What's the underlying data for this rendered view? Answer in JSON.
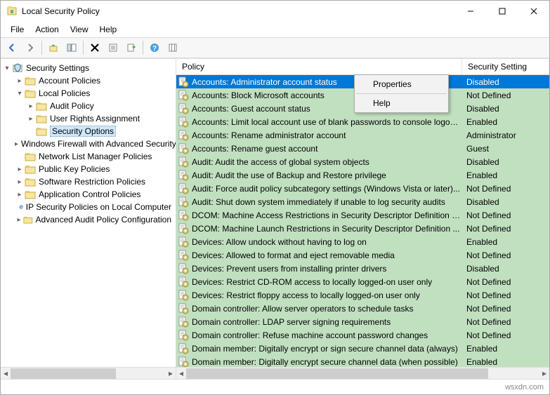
{
  "window": {
    "title": "Local Security Policy"
  },
  "menubar": [
    "File",
    "Action",
    "View",
    "Help"
  ],
  "tree": {
    "root": "Security Settings",
    "nodes": [
      {
        "label": "Account Policies",
        "depth": 1,
        "expanded": false,
        "icon": "folder",
        "twist": "▸"
      },
      {
        "label": "Local Policies",
        "depth": 1,
        "expanded": true,
        "icon": "folder",
        "twist": "▾"
      },
      {
        "label": "Audit Policy",
        "depth": 2,
        "icon": "folder",
        "twist": "▸"
      },
      {
        "label": "User Rights Assignment",
        "depth": 2,
        "icon": "folder",
        "twist": "▸"
      },
      {
        "label": "Security Options",
        "depth": 2,
        "icon": "folder",
        "twist": "",
        "selected": true
      },
      {
        "label": "Windows Firewall with Advanced Security",
        "depth": 1,
        "icon": "folder",
        "twist": "▸"
      },
      {
        "label": "Network List Manager Policies",
        "depth": 1,
        "icon": "folder",
        "twist": ""
      },
      {
        "label": "Public Key Policies",
        "depth": 1,
        "icon": "folder",
        "twist": "▸"
      },
      {
        "label": "Software Restriction Policies",
        "depth": 1,
        "icon": "folder",
        "twist": "▸"
      },
      {
        "label": "Application Control Policies",
        "depth": 1,
        "icon": "folder",
        "twist": "▸"
      },
      {
        "label": "IP Security Policies on Local Computer",
        "depth": 1,
        "icon": "ipsec",
        "twist": ""
      },
      {
        "label": "Advanced Audit Policy Configuration",
        "depth": 1,
        "icon": "folder",
        "twist": "▸"
      }
    ]
  },
  "list": {
    "headers": {
      "policy": "Policy",
      "setting": "Security Setting"
    },
    "rows": [
      {
        "name": "Accounts: Administrator account status",
        "value": "Disabled",
        "selected": true
      },
      {
        "name": "Accounts: Block Microsoft accounts",
        "value": "Not Defined"
      },
      {
        "name": "Accounts: Guest account status",
        "value": "Disabled"
      },
      {
        "name": "Accounts: Limit local account use of blank passwords to console logon only",
        "value": "Enabled"
      },
      {
        "name": "Accounts: Rename administrator account",
        "value": "Administrator"
      },
      {
        "name": "Accounts: Rename guest account",
        "value": "Guest"
      },
      {
        "name": "Audit: Audit the access of global system objects",
        "value": "Disabled"
      },
      {
        "name": "Audit: Audit the use of Backup and Restore privilege",
        "value": "Enabled"
      },
      {
        "name": "Audit: Force audit policy subcategory settings (Windows Vista or later)...",
        "value": "Not Defined"
      },
      {
        "name": "Audit: Shut down system immediately if unable to log security audits",
        "value": "Disabled"
      },
      {
        "name": "DCOM: Machine Access Restrictions in Security Descriptor Definition L...",
        "value": "Not Defined"
      },
      {
        "name": "DCOM: Machine Launch Restrictions in Security Descriptor Definition ...",
        "value": "Not Defined"
      },
      {
        "name": "Devices: Allow undock without having to log on",
        "value": "Enabled"
      },
      {
        "name": "Devices: Allowed to format and eject removable media",
        "value": "Not Defined"
      },
      {
        "name": "Devices: Prevent users from installing printer drivers",
        "value": "Disabled"
      },
      {
        "name": "Devices: Restrict CD-ROM access to locally logged-on user only",
        "value": "Not Defined"
      },
      {
        "name": "Devices: Restrict floppy access to locally logged-on user only",
        "value": "Not Defined"
      },
      {
        "name": "Domain controller: Allow server operators to schedule tasks",
        "value": "Not Defined"
      },
      {
        "name": "Domain controller: LDAP server signing requirements",
        "value": "Not Defined"
      },
      {
        "name": "Domain controller: Refuse machine account password changes",
        "value": "Not Defined"
      },
      {
        "name": "Domain member: Digitally encrypt or sign secure channel data (always)",
        "value": "Enabled"
      },
      {
        "name": "Domain member: Digitally encrypt secure channel data (when possible)",
        "value": "Enabled"
      }
    ]
  },
  "context_menu": {
    "items": [
      "Properties",
      "Help"
    ]
  },
  "footer": {
    "site": "wsxdn.com"
  }
}
